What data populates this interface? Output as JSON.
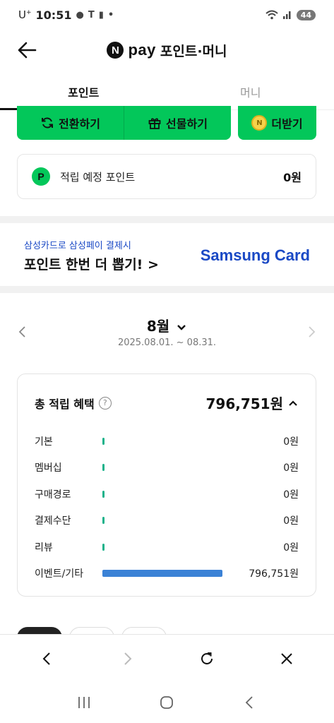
{
  "status_bar": {
    "carrier": "U",
    "carrier_sup": "+",
    "time": "10:51",
    "battery": "44"
  },
  "header": {
    "logo_letter": "N",
    "pay_word": "pay",
    "title": "포인트·머니"
  },
  "tabs": [
    {
      "label": "포인트",
      "active": true
    },
    {
      "label": "머니",
      "active": false
    }
  ],
  "actions": {
    "convert_label": "전환하기",
    "gift_label": "선물하기",
    "more_label": "더받기",
    "coin_letter": "N"
  },
  "pending": {
    "badge": "P",
    "label": "적립 예정 포인트",
    "value": "0원"
  },
  "banner": {
    "sub": "삼성카드로 삼성페이 결제시",
    "main": "포인트 한번 더 뽑기! >",
    "logo": "Samsung Card"
  },
  "month": {
    "title": "8월",
    "range": "2025.08.01. ~ 08.31."
  },
  "summary": {
    "title": "총 적립 혜택",
    "help": "?",
    "total": "796,751원",
    "rows": [
      {
        "label": "기본",
        "value": "0원",
        "fraction": 0
      },
      {
        "label": "멤버십",
        "value": "0원",
        "fraction": 0
      },
      {
        "label": "구매경로",
        "value": "0원",
        "fraction": 0
      },
      {
        "label": "결제수단",
        "value": "0원",
        "fraction": 0
      },
      {
        "label": "리뷰",
        "value": "0원",
        "fraction": 0
      },
      {
        "label": "이벤트/기타",
        "value": "796,751원",
        "fraction": 1
      }
    ]
  },
  "colors": {
    "naver_green": "#03c75a",
    "samsung_blue": "#1a49c5",
    "bar_blue": "#3b82d6",
    "bar_small": "#19b28a"
  }
}
